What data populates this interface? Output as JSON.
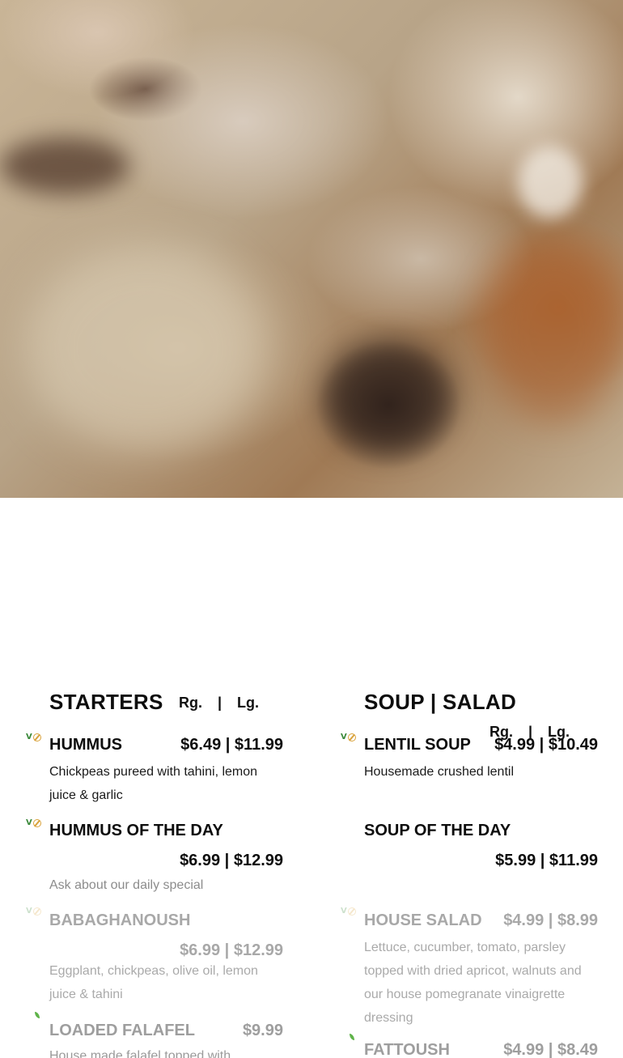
{
  "hero": {
    "image": "food-photo"
  },
  "starters": {
    "title": "STARTERS",
    "size_header": "Rg. | Lg.",
    "items": [
      {
        "name": "HUMMUS",
        "price": "$6.49 | $11.99",
        "desc": "Chickpeas pureed with tahini, lemon juice & garlic",
        "badge": "vegan-gluten-free-icon"
      },
      {
        "name": "HUMMUS OF THE DAY",
        "price": "$6.99 | $12.99",
        "desc": "Ask about our daily special",
        "badge": "vegan-gluten-free-icon"
      },
      {
        "name": "BABAGHANOUSH",
        "price": "$6.99 | $12.99",
        "desc": "Eggplant, chickpeas, olive oil, lemon juice & tahini",
        "badge": "vegan-gluten-free-icon"
      },
      {
        "name": "LOADED FALAFEL",
        "price": "$9.99",
        "desc": "House made falafel topped with",
        "badge": "leaf-icon"
      }
    ]
  },
  "soup_salad": {
    "title": "SOUP | SALAD",
    "size_header": "Rg. | Lg.",
    "items": [
      {
        "name": "LENTIL SOUP",
        "price": "$4.99 | $10.49",
        "desc": "Housemade crushed lentil",
        "badge": "vegan-gluten-free-icon"
      },
      {
        "name": "SOUP OF THE DAY",
        "price": "$5.99 | $11.99",
        "desc": ""
      },
      {
        "name": "HOUSE SALAD",
        "price": "$4.99 | $8.99",
        "desc": "Lettuce, cucumber, tomato, parsley topped with dried apricot, walnuts and our house pomegranate vinaigrette dressing",
        "badge": "vegan-gluten-free-icon"
      },
      {
        "name": "FATTOUSH",
        "price": "$4.99 | $8.49",
        "desc": "",
        "badge": "leaf-icon"
      }
    ]
  }
}
